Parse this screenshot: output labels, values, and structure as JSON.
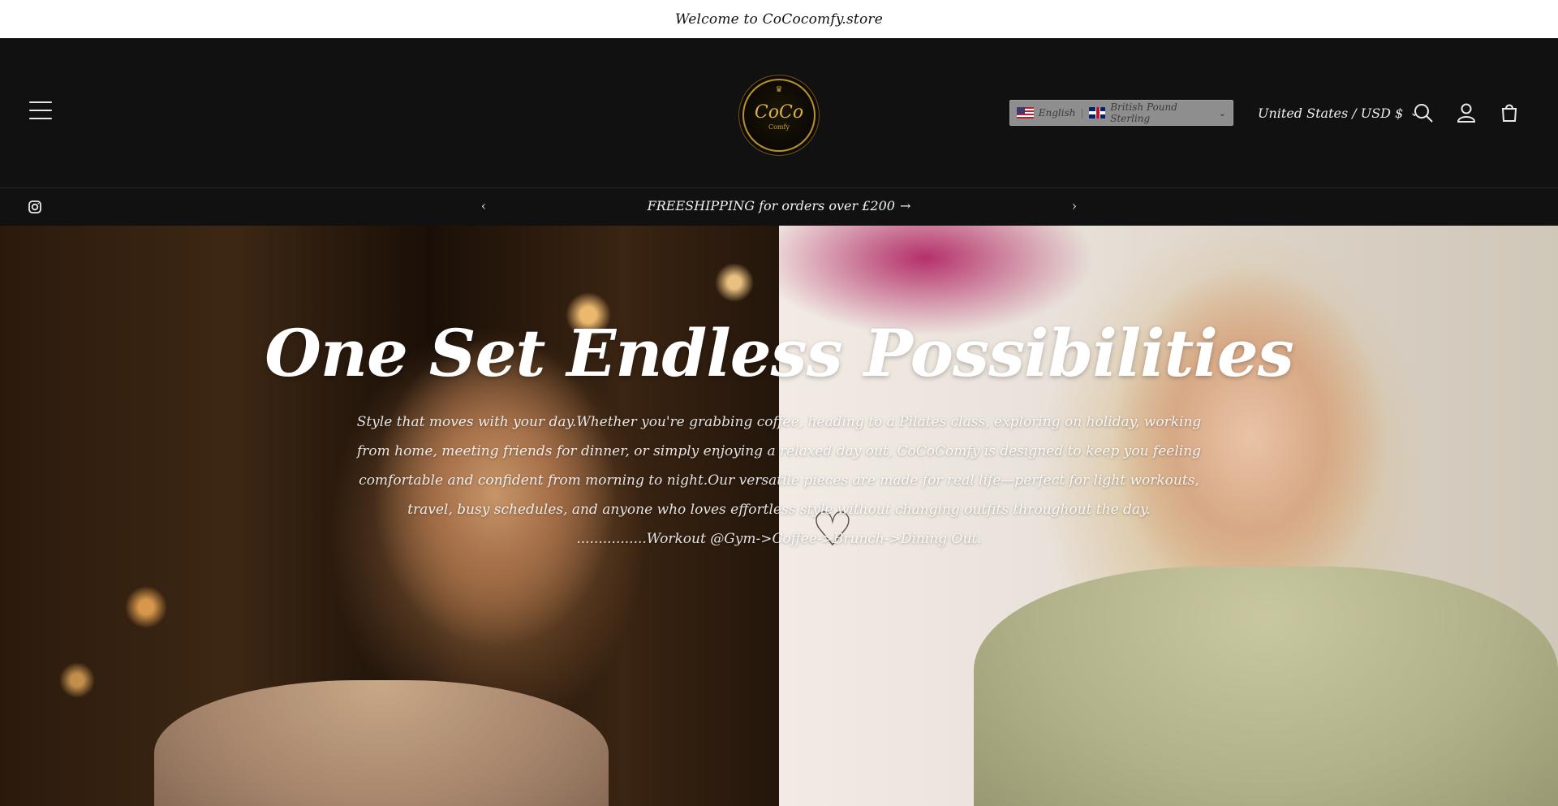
{
  "welcome_bar": {
    "text": "Welcome to CoCocomfy.store"
  },
  "header": {
    "logo": {
      "main": "CoCo",
      "sub": "Comfy"
    },
    "language_selector": {
      "language": "English",
      "currency": "British Pound Sterling"
    },
    "country_selector": {
      "label": "United States / USD $"
    }
  },
  "announcement": {
    "text": "FREESHIPPING for orders over £200"
  },
  "hero": {
    "title": "One Set Endless Possibilities",
    "description": "Style that moves with your day.Whether you're grabbing coffee, heading to a Pilates class, exploring on holiday, working from home, meeting friends for dinner, or simply enjoying a relaxed day out, CoCoComfy is designed to keep you feeling comfortable and confident from morning to night.Our versatile pieces are made for real life—perfect for light workouts, travel, busy schedules, and anyone who loves effortless style without changing outfits throughout the day. ................Workout @Gym->Coffee->Brunch->Dining Out."
  },
  "icons": {
    "menu": "hamburger-menu-icon",
    "search": "search-icon",
    "account": "account-icon",
    "cart": "cart-icon",
    "instagram": "instagram-icon",
    "prev": "chevron-left-icon",
    "next": "chevron-right-icon"
  },
  "colors": {
    "header_bg": "#111111",
    "welcome_bg": "#ffffff",
    "logo_gold": "#d9b04a"
  }
}
